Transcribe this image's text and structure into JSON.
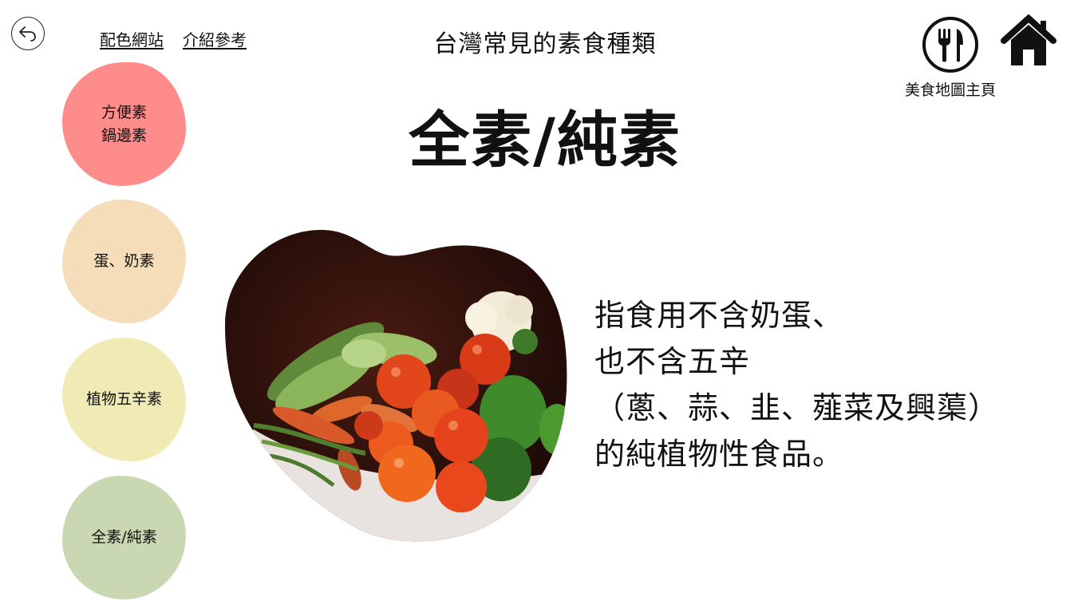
{
  "nav": {
    "back_icon": "back-arrow-icon",
    "links": [
      {
        "label": "配色網站"
      },
      {
        "label": "介紹參考"
      }
    ]
  },
  "header": {
    "title": "台灣常見的素食種類"
  },
  "top_right": {
    "food_map_icon": "fork-knife-icon",
    "home_icon": "home-icon",
    "food_map_label": "美食地圖主頁"
  },
  "sidebar": {
    "items": [
      {
        "label": "方便素\n鍋邊素",
        "color": "#fd8c8a"
      },
      {
        "label": "蛋、奶素",
        "color": "#f4ddb8"
      },
      {
        "label": "植物五辛素",
        "color": "#f0ebb4"
      },
      {
        "label": "全素/純素",
        "color": "#c9d8b3"
      }
    ]
  },
  "main": {
    "heading": "全素/純素",
    "description": "指食用不含奶蛋、\n也不含五辛\n（蔥、蒜、韭、薤菜及興蕖）\n的純植物性食品。"
  }
}
